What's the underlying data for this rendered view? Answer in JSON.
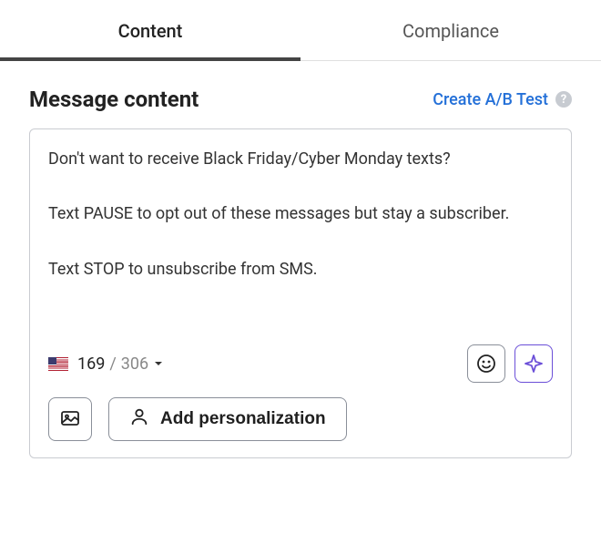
{
  "tabs": {
    "content": "Content",
    "compliance": "Compliance"
  },
  "section": {
    "title": "Message content",
    "ab_test": "Create A/B Test"
  },
  "message": {
    "text": "Don't want to receive Black Friday/Cyber Monday texts?\n\nText PAUSE to opt out of these messages but stay a subscriber.\n\nText STOP to unsubscribe from SMS."
  },
  "counter": {
    "count": "169",
    "slash": "/",
    "limit": "306"
  },
  "actions": {
    "personalization": "Add personalization"
  }
}
